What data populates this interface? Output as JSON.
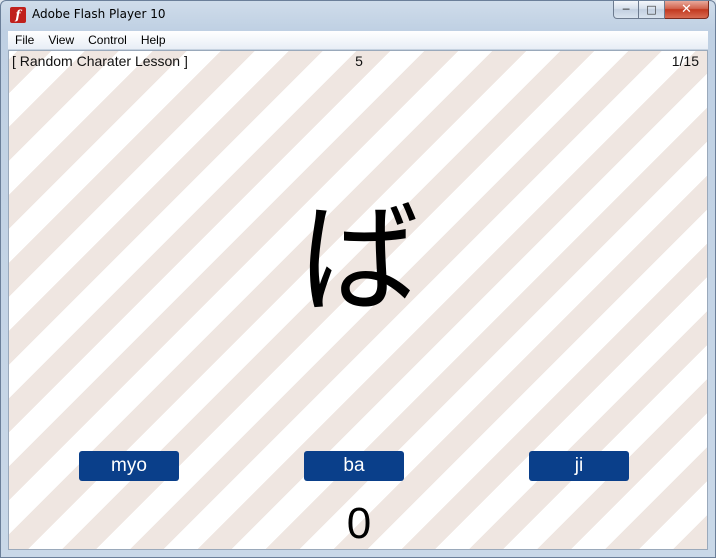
{
  "window": {
    "title": "Adobe Flash Player 10",
    "icon": "flash-icon",
    "icon_glyph": "f",
    "controls": {
      "minimize": "minimize-icon",
      "maximize": "maximize-icon",
      "close": "close-icon"
    }
  },
  "menu": {
    "items": [
      {
        "label": "File"
      },
      {
        "label": "View"
      },
      {
        "label": "Control"
      },
      {
        "label": "Help"
      }
    ]
  },
  "lesson": {
    "title": "[ Random Charater Lesson ]",
    "level": "5",
    "progress": "1/15",
    "character": "ば",
    "answers": [
      {
        "label": "myo"
      },
      {
        "label": "ba"
      },
      {
        "label": "ji"
      }
    ],
    "score": "0"
  },
  "colors": {
    "button_bg": "#0a3f8a",
    "stripe_light": "#efe6e1",
    "stripe_white": "#ffffff"
  }
}
